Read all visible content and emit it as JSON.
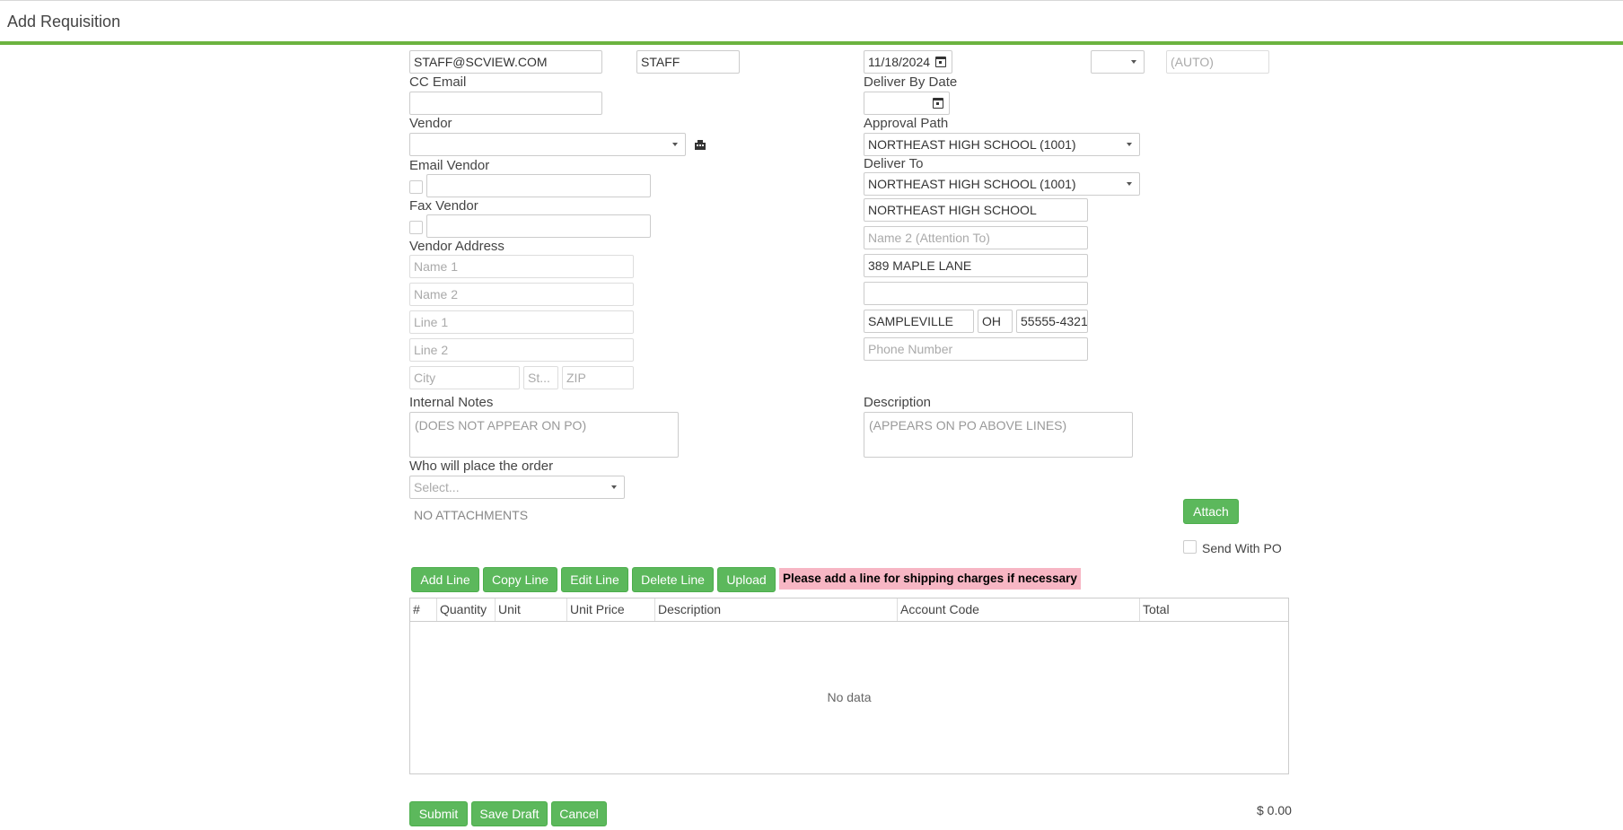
{
  "window": {
    "title": "Add Requisition"
  },
  "colors": {
    "accent": "#6cb33f",
    "button": "#5cb85c",
    "notice_bg": "#f7b6c4"
  },
  "header_row": {
    "email_value": "STAFF@SCVIEW.COM",
    "user_value": "STAFF",
    "date_value": "11/18/2024",
    "auto_placeholder": "(AUTO)"
  },
  "left": {
    "cc_email_label": "CC Email",
    "vendor_label": "Vendor",
    "vendor_value": "",
    "email_vendor_label": "Email Vendor",
    "fax_vendor_label": "Fax Vendor",
    "vendor_address_label": "Vendor Address",
    "name1_placeholder": "Name 1",
    "name2_placeholder": "Name 2",
    "line1_placeholder": "Line 1",
    "line2_placeholder": "Line 2",
    "city_placeholder": "City",
    "state_placeholder": "St...",
    "zip_placeholder": "ZIP",
    "internal_notes_label": "Internal Notes",
    "internal_notes_placeholder": "(DOES NOT APPEAR ON PO)",
    "who_place_label": "Who will place the order",
    "who_place_placeholder": "Select...",
    "attachments_text": "NO ATTACHMENTS"
  },
  "right": {
    "deliver_by_label": "Deliver By Date",
    "approval_path_label": "Approval Path",
    "approval_path_value": "NORTHEAST HIGH SCHOOL (1001)",
    "deliver_to_label": "Deliver To",
    "deliver_to_value": "NORTHEAST HIGH SCHOOL (1001)",
    "name1_value": "NORTHEAST HIGH SCHOOL",
    "name2_placeholder": "Name 2 (Attention To)",
    "line1_value": "389 MAPLE LANE",
    "line2_value": "",
    "city_value": "SAMPLEVILLE",
    "state_value": "OH",
    "zip_value": "55555-4321",
    "phone_placeholder": "Phone Number",
    "description_label": "Description",
    "description_placeholder": "(APPEARS ON PO ABOVE LINES)",
    "attach_button": "Attach",
    "send_with_po_label": "Send With PO"
  },
  "toolbar": {
    "add_line": "Add Line",
    "copy_line": "Copy Line",
    "edit_line": "Edit Line",
    "delete_line": "Delete Line",
    "upload": "Upload",
    "notice": "Please add a line for shipping charges if necessary"
  },
  "grid": {
    "columns": [
      "#",
      "Quantity",
      "Unit",
      "Unit Price",
      "Description",
      "Account Code",
      "Total"
    ],
    "empty_text": "No data"
  },
  "footer": {
    "submit": "Submit",
    "save_draft": "Save Draft",
    "cancel": "Cancel",
    "total": "$ 0.00"
  }
}
